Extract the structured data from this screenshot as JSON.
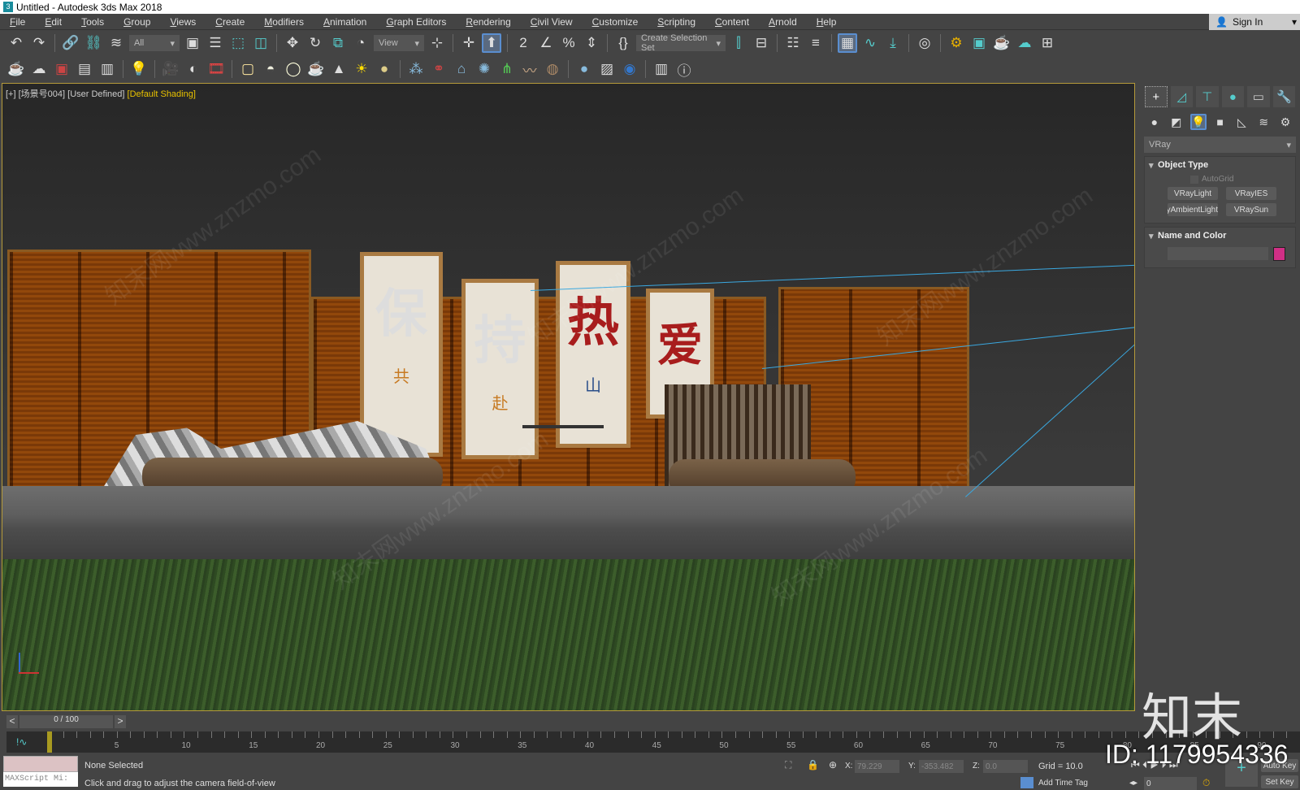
{
  "window": {
    "title": "Untitled - Autodesk 3ds Max 2018",
    "icon": "3"
  },
  "menu": [
    "File",
    "Edit",
    "Tools",
    "Group",
    "Views",
    "Create",
    "Modifiers",
    "Animation",
    "Graph Editors",
    "Rendering",
    "Civil View",
    "Customize",
    "Scripting",
    "Content",
    "Arnold",
    "Help"
  ],
  "signin": {
    "label": "Sign In",
    "icon": "user-icon"
  },
  "toolbar": {
    "selection_filter": "All",
    "ref_coord": "View",
    "selection_set": "Create Selection Set"
  },
  "viewport": {
    "label_plus": "[+]",
    "label_cam": "[场景号004]",
    "label_view": "[User Defined]",
    "label_shading": "[Default Shading]",
    "banners": [
      {
        "big": "保",
        "small": "共"
      },
      {
        "big": "持",
        "small": "赴"
      },
      {
        "big": "热",
        "small": "山"
      },
      {
        "big": "爱",
        "small": ""
      }
    ],
    "watermark": "知末网www.znzmo.com"
  },
  "panel": {
    "category": "VRay",
    "object_type": {
      "title": "Object Type",
      "autogrid": "AutoGrid",
      "buttons": [
        "VRayLight",
        "VRayIES",
        "VRayAmbientLight",
        "VRaySun"
      ]
    },
    "name_color": {
      "title": "Name and Color",
      "name": "",
      "color": "#d12f86"
    }
  },
  "timeline": {
    "position": "0 / 100",
    "current": 0,
    "ticks": [
      0,
      5,
      10,
      15,
      20,
      25,
      30,
      35,
      40,
      45,
      50,
      55,
      60,
      65,
      70,
      75,
      80,
      85,
      90
    ]
  },
  "status": {
    "maxscript": "MAXScript Mi:",
    "selection": "None Selected",
    "prompt": "Click and drag to adjust the camera field-of-view",
    "x_label": "X:",
    "x": "79.229",
    "y_label": "Y:",
    "y": "-353.482",
    "z_label": "Z:",
    "z": "0.0",
    "grid": "Grid = 10.0",
    "add_time_tag": "Add Time Tag",
    "frame": "0",
    "auto_key": "Auto Key",
    "set_key": "Set Key"
  },
  "brand_watermark": {
    "logo": "知末",
    "id": "ID: 1179954336"
  }
}
